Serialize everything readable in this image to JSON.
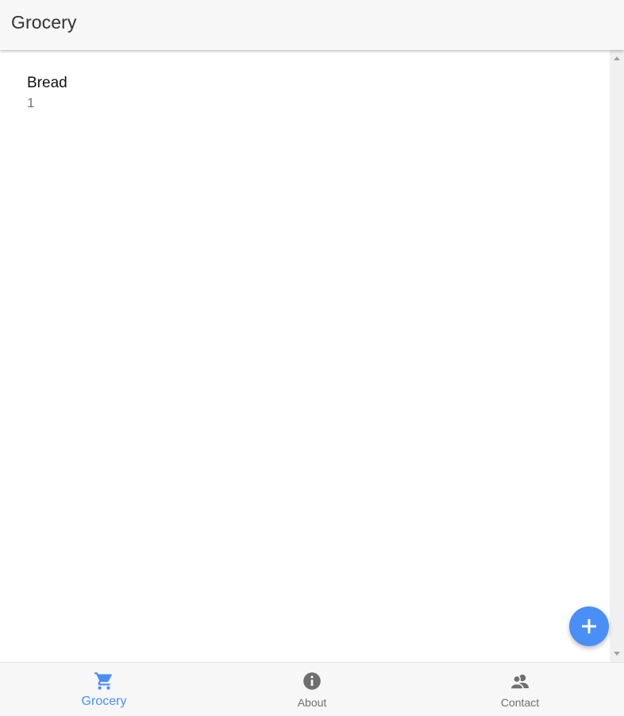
{
  "header": {
    "title": "Grocery"
  },
  "list": {
    "items": [
      {
        "name": "Bread",
        "quantity": "1"
      }
    ]
  },
  "fab": {
    "icon": "plus-icon",
    "color": "#4a8ff7"
  },
  "bottom_nav": {
    "active_color": "#4a8ff7",
    "inactive_color": "#6f6f6f",
    "items": [
      {
        "label": "Grocery",
        "icon": "shopping-cart-icon",
        "active": true
      },
      {
        "label": "About",
        "icon": "info-icon",
        "active": false
      },
      {
        "label": "Contact",
        "icon": "contacts-icon",
        "active": false
      }
    ]
  }
}
